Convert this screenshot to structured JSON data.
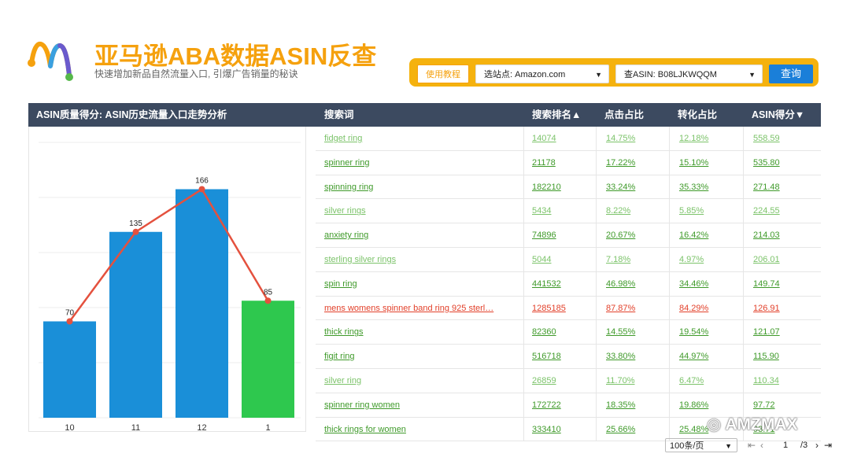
{
  "header": {
    "title": "亚马逊ABA数据ASIN反查",
    "subtitle": "快速增加新品自然流量入口, 引爆广告销量的秘诀"
  },
  "toolbar": {
    "tutorial_label": "使用教程",
    "site_select": "选站点: Amazon.com",
    "asin_select": "查ASIN: B08LJKWQQM",
    "query_label": "查询"
  },
  "panel": {
    "chart_title": "ASIN质量得分: ASIN历史流量入口走势分析",
    "columns": [
      "搜索词",
      "搜索排名▲",
      "点击占比",
      "转化占比",
      "ASIN得分▼"
    ]
  },
  "chart_data": {
    "type": "bar",
    "categories": [
      "10",
      "11",
      "12",
      "1"
    ],
    "values": [
      70,
      135,
      166,
      85
    ],
    "bar_colors": [
      "#1a8fd8",
      "#1a8fd8",
      "#1a8fd8",
      "#2ec84e"
    ],
    "line_color": "#e4513e",
    "title": "",
    "xlabel": "",
    "ylabel": "",
    "ylim": [
      0,
      200
    ],
    "grid": true
  },
  "rows": [
    {
      "term": "fidget ring",
      "rank": "14074",
      "click": "14.75%",
      "conv": "12.18%",
      "score": "558.59",
      "tone": "lt"
    },
    {
      "term": "spinner ring",
      "rank": "21178",
      "click": "17.22%",
      "conv": "15.10%",
      "score": "535.80",
      "tone": "dk"
    },
    {
      "term": "spinning ring",
      "rank": "182210",
      "click": "33.24%",
      "conv": "35.33%",
      "score": "271.48",
      "tone": "dk"
    },
    {
      "term": "silver rings",
      "rank": "5434",
      "click": "8.22%",
      "conv": "5.85%",
      "score": "224.55",
      "tone": "lt"
    },
    {
      "term": "anxiety ring",
      "rank": "74896",
      "click": "20.67%",
      "conv": "16.42%",
      "score": "214.03",
      "tone": "dk"
    },
    {
      "term": "sterling silver rings",
      "rank": "5044",
      "click": "7.18%",
      "conv": "4.97%",
      "score": "206.01",
      "tone": "lt"
    },
    {
      "term": "spin ring",
      "rank": "441532",
      "click": "46.98%",
      "conv": "34.46%",
      "score": "149.74",
      "tone": "dk"
    },
    {
      "term": "mens womens spinner band ring 925 sterl…",
      "rank": "1285185",
      "click": "87.87%",
      "conv": "84.29%",
      "score": "126.91",
      "tone": "rd"
    },
    {
      "term": "thick rings",
      "rank": "82360",
      "click": "14.55%",
      "conv": "19.54%",
      "score": "121.07",
      "tone": "dk"
    },
    {
      "term": "figit ring",
      "rank": "516718",
      "click": "33.80%",
      "conv": "44.97%",
      "score": "115.90",
      "tone": "dk"
    },
    {
      "term": "silver ring",
      "rank": "26859",
      "click": "11.70%",
      "conv": "6.47%",
      "score": "110.34",
      "tone": "lt"
    },
    {
      "term": "spinner ring women",
      "rank": "172722",
      "click": "18.35%",
      "conv": "19.86%",
      "score": "97.72",
      "tone": "dk"
    },
    {
      "term": "thick rings for women",
      "rank": "333410",
      "click": "25.66%",
      "conv": "25.48%",
      "score": "93.71",
      "tone": "dk"
    }
  ],
  "footer": {
    "page_size": "100条/页",
    "current_page": "1",
    "total_pages": "/3"
  },
  "watermark": "AMZMAX"
}
